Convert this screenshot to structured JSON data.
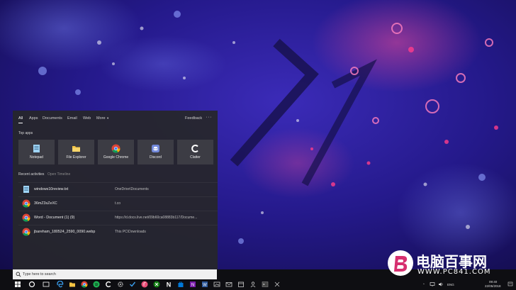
{
  "search_panel": {
    "tabs": [
      "All",
      "Apps",
      "Documents",
      "Email",
      "Web"
    ],
    "more_label": "More",
    "feedback_label": "Feedback",
    "ellipsis": "···",
    "top_apps_title": "Top apps",
    "top_apps": [
      {
        "label": "Notepad",
        "icon": "notepad-icon"
      },
      {
        "label": "File Explorer",
        "icon": "folder-icon"
      },
      {
        "label": "Google Chrome",
        "icon": "chrome-icon"
      },
      {
        "label": "Discord",
        "icon": "discord-icon"
      },
      {
        "label": "Clatter",
        "icon": "clatter-icon"
      }
    ],
    "recent_title": "Recent activities",
    "open_timeline": "Open Timeline",
    "recent": [
      {
        "name": "windows10review.txt",
        "location": "OneDrive\\Documents",
        "icon": "notepad-icon"
      },
      {
        "name": "36mZ3sZeXC",
        "location": "t.co",
        "icon": "chrome-icon"
      },
      {
        "name": "Word - Document (1) (9)",
        "location": "https://d.docs.live.net/09b60ca08883b117/Docume...",
        "icon": "chrome-icon"
      },
      {
        "name": "jbareham_180524_2590_0090.webp",
        "location": "This PC\\Downloads",
        "icon": "chrome-icon"
      }
    ]
  },
  "taskbar": {
    "search_placeholder": "Type here to search",
    "lang": "ENG",
    "time": "09:40",
    "date": "22/05/2018"
  },
  "watermark": {
    "title": "电脑百事网",
    "url": "WWW.PC841.COM"
  },
  "colors": {
    "panel_bg": "#26262c",
    "tile_bg": "#3c3c44",
    "taskbar_bg": "#0e0e12",
    "wallpaper_primary": "#2a1f8f",
    "wallpaper_accent": "#ff3d8b"
  }
}
